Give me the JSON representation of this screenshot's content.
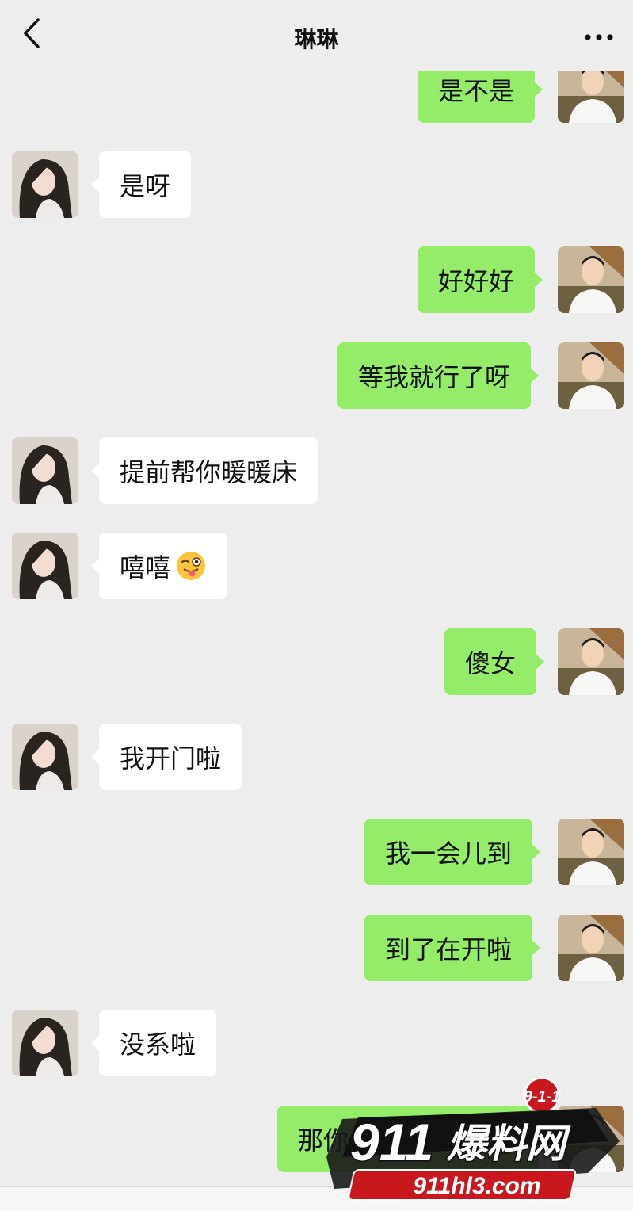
{
  "header": {
    "title": "琳琳",
    "back_icon": "chevron-left-icon",
    "more_icon": "more-dots-icon"
  },
  "messages": [
    {
      "side": "out",
      "text": "是不是"
    },
    {
      "side": "in",
      "text": "是呀"
    },
    {
      "side": "out",
      "text": "好好好"
    },
    {
      "side": "out",
      "text": "等我就行了呀"
    },
    {
      "side": "in",
      "text": "提前帮你暖暖床"
    },
    {
      "side": "in",
      "text": "嘻嘻",
      "emoji": "winking-tongue-emoji"
    },
    {
      "side": "out",
      "text": "傻女"
    },
    {
      "side": "in",
      "text": "我开门啦"
    },
    {
      "side": "out",
      "text": "我一会儿到"
    },
    {
      "side": "out",
      "text": "到了在开啦"
    },
    {
      "side": "in",
      "text": "没系啦"
    },
    {
      "side": "out",
      "text": "那你"
    }
  ],
  "watermark": {
    "badge": "9-1-1",
    "brand_num": "911",
    "brand_text": "爆料网",
    "url": "911hl3.com"
  },
  "colors": {
    "background": "#ededed",
    "outgoing_bubble": "#95ec69",
    "incoming_bubble": "#ffffff"
  }
}
